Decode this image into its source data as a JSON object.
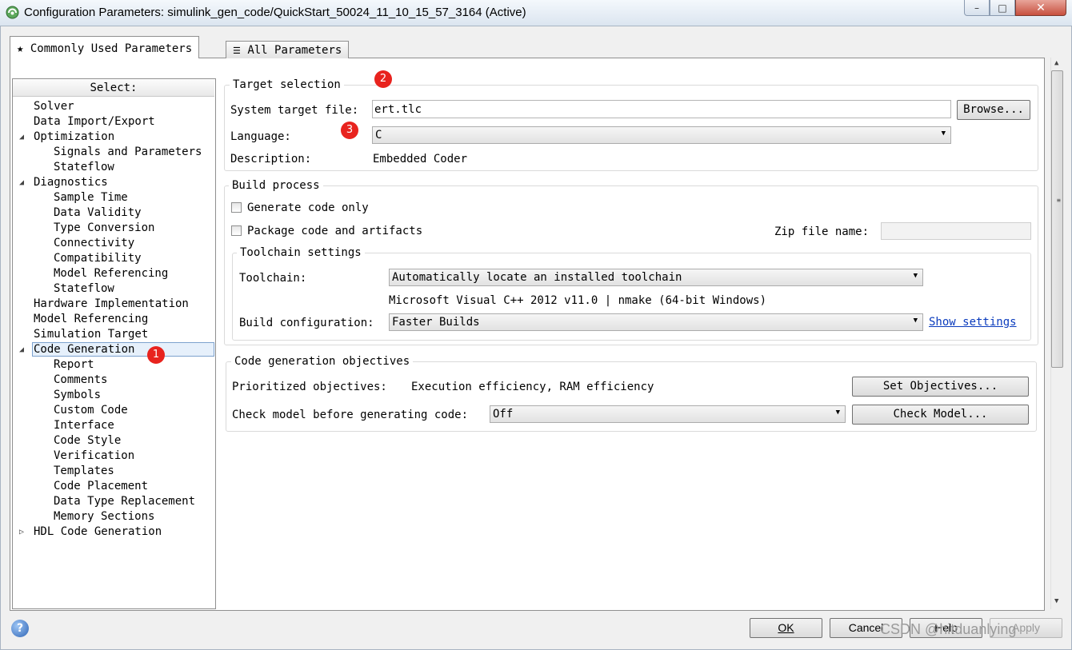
{
  "window": {
    "title": "Configuration Parameters: simulink_gen_code/QuickStart_50024_11_10_15_57_3164 (Active)",
    "controls": {
      "minimize": "–",
      "maximize": "□",
      "close": "✕"
    }
  },
  "tabs": [
    {
      "label": "Commonly Used Parameters",
      "icon": "star-icon",
      "glyph": "★"
    },
    {
      "label": "All Parameters",
      "icon": "list-icon",
      "glyph": "☰"
    }
  ],
  "tree": {
    "header": "Select:",
    "items": [
      {
        "label": "Solver"
      },
      {
        "label": "Data Import/Export"
      },
      {
        "label": "Optimization",
        "expander": "◢"
      },
      {
        "label": "Signals and Parameters"
      },
      {
        "label": "Stateflow"
      },
      {
        "label": "Diagnostics",
        "expander": "◢"
      },
      {
        "label": "Sample Time"
      },
      {
        "label": "Data Validity"
      },
      {
        "label": "Type Conversion"
      },
      {
        "label": "Connectivity"
      },
      {
        "label": "Compatibility"
      },
      {
        "label": "Model Referencing"
      },
      {
        "label": "Stateflow"
      },
      {
        "label": "Hardware Implementation"
      },
      {
        "label": "Model Referencing"
      },
      {
        "label": "Simulation Target"
      },
      {
        "label": "Code Generation",
        "expander": "◢"
      },
      {
        "label": "Report"
      },
      {
        "label": "Comments"
      },
      {
        "label": "Symbols"
      },
      {
        "label": "Custom Code"
      },
      {
        "label": "Interface"
      },
      {
        "label": "Code Style"
      },
      {
        "label": "Verification"
      },
      {
        "label": "Templates"
      },
      {
        "label": "Code Placement"
      },
      {
        "label": "Data Type Replacement"
      },
      {
        "label": "Memory Sections"
      },
      {
        "label": "HDL Code Generation",
        "expander": "▷"
      }
    ]
  },
  "badges": {
    "b1": "1",
    "b2": "2",
    "b3": "3"
  },
  "target_selection": {
    "legend": "Target selection",
    "system_target_label": "System target file:",
    "system_target_value": "ert.tlc",
    "browse_label": "Browse...",
    "language_label": "Language:",
    "language_value": "C",
    "description_label": "Description:",
    "description_value": "Embedded Coder"
  },
  "build_process": {
    "legend": "Build process",
    "generate_only_label": "Generate code only",
    "package_label": "Package code and artifacts",
    "zip_label": "Zip file name:",
    "zip_value": ""
  },
  "toolchain": {
    "legend": "Toolchain settings",
    "toolchain_label": "Toolchain:",
    "toolchain_value": "Automatically locate an installed toolchain",
    "toolchain_detected": "Microsoft Visual C++ 2012 v11.0 | nmake (64-bit Windows)",
    "build_config_label": "Build configuration:",
    "build_config_value": "Faster Builds",
    "show_settings_label": "Show settings"
  },
  "objectives": {
    "legend": "Code generation objectives",
    "prioritized_label": "Prioritized objectives:",
    "prioritized_value": "Execution efficiency, RAM efficiency",
    "set_objectives_label": "Set Objectives...",
    "check_label": "Check model before generating code:",
    "check_value": "Off",
    "check_model_label": "Check Model..."
  },
  "footer": {
    "help_glyph": "?",
    "ok_label": "OK",
    "cancel_label": "Cancel",
    "help_label": "Help",
    "apply_label": "Apply",
    "watermark": "CSDN @hitduanlying"
  }
}
